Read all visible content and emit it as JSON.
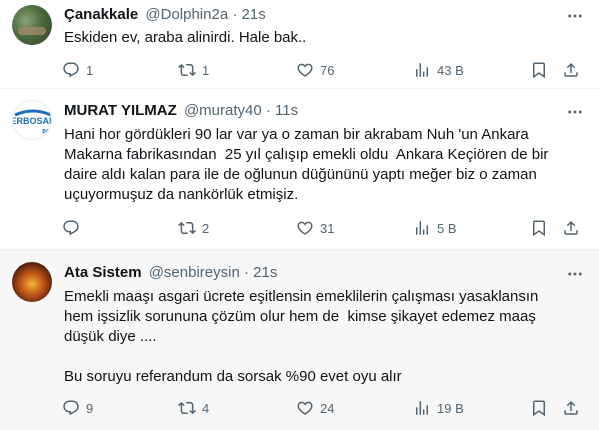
{
  "tweets": [
    {
      "name": "Çanakkale",
      "handle": "@Dolphin2a",
      "dot": "·",
      "time": "21s",
      "text": "Eskiden ev, araba alinirdi. Hale bak..",
      "replies": "1",
      "retweets": "1",
      "likes": "76",
      "views": "43 B"
    },
    {
      "name": "MURAT YILMAZ",
      "handle": "@muraty40",
      "dot": "·",
      "time": "11s",
      "text": "Hani hor gördükleri 90 lar var ya o zaman bir akrabam Nuh 'un Ankara\nMakarna fabrikasından  25 yıl çalışıp emekli oldu  Ankara Keçiören de bir\ndaire aldı kalan para ile de oğlunun düğününü yaptı meğer biz o zaman\nuçuyormuşuz da nankörlük etmişiz.",
      "avatar_text": "ERBOSAN",
      "avatar_sub": "BO",
      "replies": "",
      "retweets": "2",
      "likes": "31",
      "views": "5 B"
    },
    {
      "name": "Ata Sistem",
      "handle": "@senbireysin",
      "dot": "·",
      "time": "21s",
      "text": "Emekli maaşı asgari ücrete eşitlensin emeklilerin çalışması yasaklansın\nhem işsizlik sorununa çözüm olur hem de  kimse şikayet edemez maaş\ndüşük diye ....\n\nBu soruyu referandum da sorsak %90 evet oyu alır",
      "replies": "9",
      "retweets": "4",
      "likes": "24",
      "views": "19 B"
    }
  ],
  "icons": {
    "reply": "reply-icon",
    "retweet": "retweet-icon",
    "like": "heart-icon",
    "views": "views-icon",
    "bookmark": "bookmark-icon",
    "share": "share-icon",
    "more": "more-icon"
  },
  "colors": {
    "text": "#0f1419",
    "secondary": "#536471",
    "highlight_bg": "#f7f7f7",
    "divider": "#eff3f4",
    "erbosan_blue": "#1f6fb5"
  }
}
